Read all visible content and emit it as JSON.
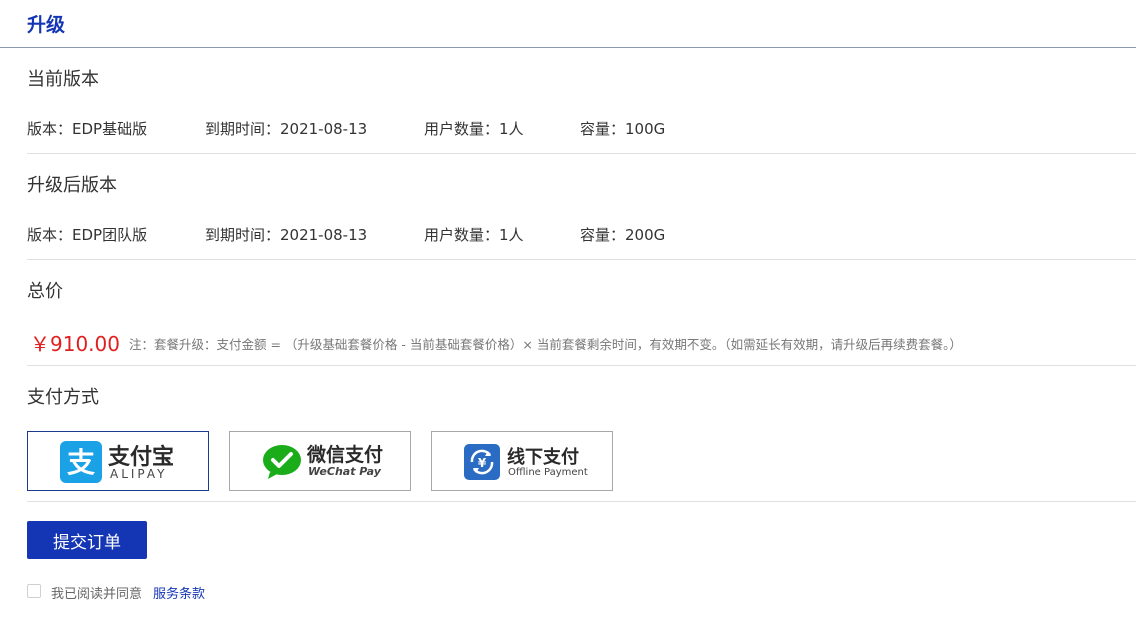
{
  "header": {
    "title": "升级"
  },
  "current": {
    "section_title": "当前版本",
    "version": "版本：EDP基础版",
    "expiry": "到期时间：2021-08-13",
    "users": "用户数量：1人",
    "capacity": "容量：100G"
  },
  "upgraded": {
    "section_title": "升级后版本",
    "version": "版本：EDP团队版",
    "expiry": "到期时间：2021-08-13",
    "users": "用户数量：1人",
    "capacity": "容量：200G"
  },
  "total": {
    "section_title": "总价",
    "price": "￥910.00",
    "note": "注：套餐升级：支付金额 = （升级基础套餐价格 - 当前基础套餐价格）× 当前套餐剩余时间，有效期不变。（如需延长有效期，请升级后再续费套餐。）"
  },
  "payment": {
    "section_title": "支付方式",
    "selected": "alipay",
    "methods": [
      {
        "id": "alipay",
        "label": "支付宝",
        "sub": "ALIPAY",
        "icon": "alipay-icon",
        "color": "#1aa1e6"
      },
      {
        "id": "wechat",
        "label": "微信支付",
        "sub": "WeChat Pay",
        "icon": "wechat-pay-icon",
        "color": "#1aad19"
      },
      {
        "id": "offline",
        "label": "线下支付",
        "sub": "Offline Payment",
        "icon": "offline-payment-icon",
        "color": "#2a6bc4"
      }
    ]
  },
  "submit": {
    "label": "提交订单"
  },
  "agreement": {
    "text": "我已阅读并同意",
    "link": "服务条款"
  },
  "colors": {
    "brand": "#1436b4",
    "price": "#e02020",
    "border": "#e0e0e0"
  }
}
